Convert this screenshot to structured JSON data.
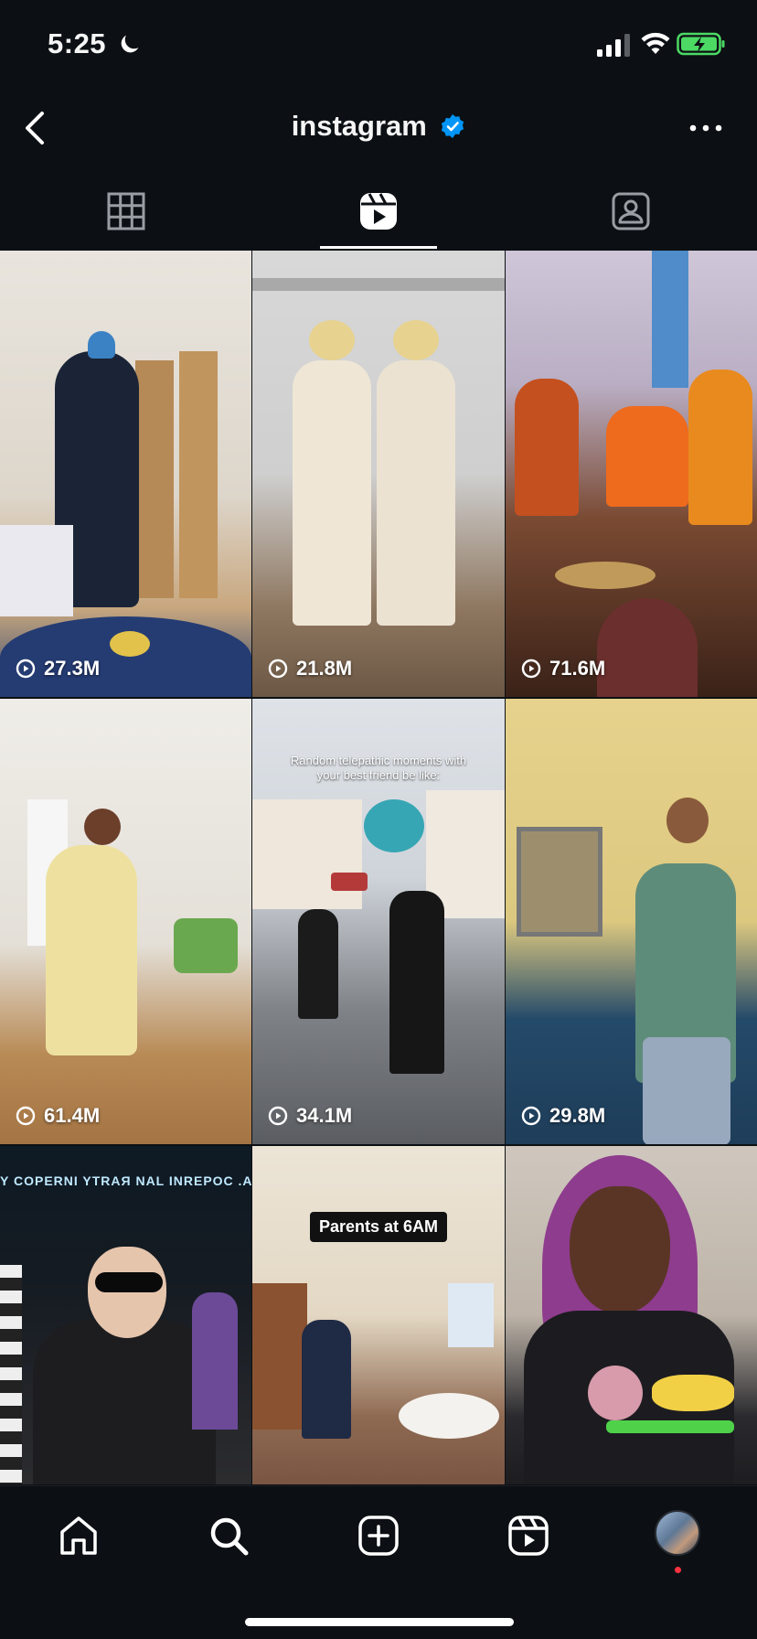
{
  "status_bar": {
    "time": "5:25",
    "battery_color": "#4cd964"
  },
  "header": {
    "title": "instagram",
    "verified_color": "#0095f6"
  },
  "tabs": [
    {
      "name": "grid",
      "icon": "grid-icon",
      "active": false
    },
    {
      "name": "reels",
      "icon": "reels-icon",
      "active": true
    },
    {
      "name": "tagged",
      "icon": "tagged-icon",
      "active": false
    }
  ],
  "reels": [
    {
      "views": "27.3M",
      "caption": ""
    },
    {
      "views": "21.8M",
      "caption": ""
    },
    {
      "views": "71.6M",
      "caption": ""
    },
    {
      "views": "61.4M",
      "caption": ""
    },
    {
      "views": "34.1M",
      "caption": "Random telepathic moments with your best friend be like:"
    },
    {
      "views": "29.8M",
      "caption": ""
    },
    {
      "views": "",
      "caption": "Y COPERNI YTRAЯ NAL INREPOC .A'.PAR"
    },
    {
      "views": "",
      "caption": "Parents at 6AM"
    },
    {
      "views": "",
      "caption": ""
    }
  ],
  "bottom_nav": {
    "items": [
      "home-icon",
      "search-icon",
      "create-icon",
      "reels-nav-icon",
      "profile-avatar"
    ],
    "notification_color": "#ff3040"
  }
}
